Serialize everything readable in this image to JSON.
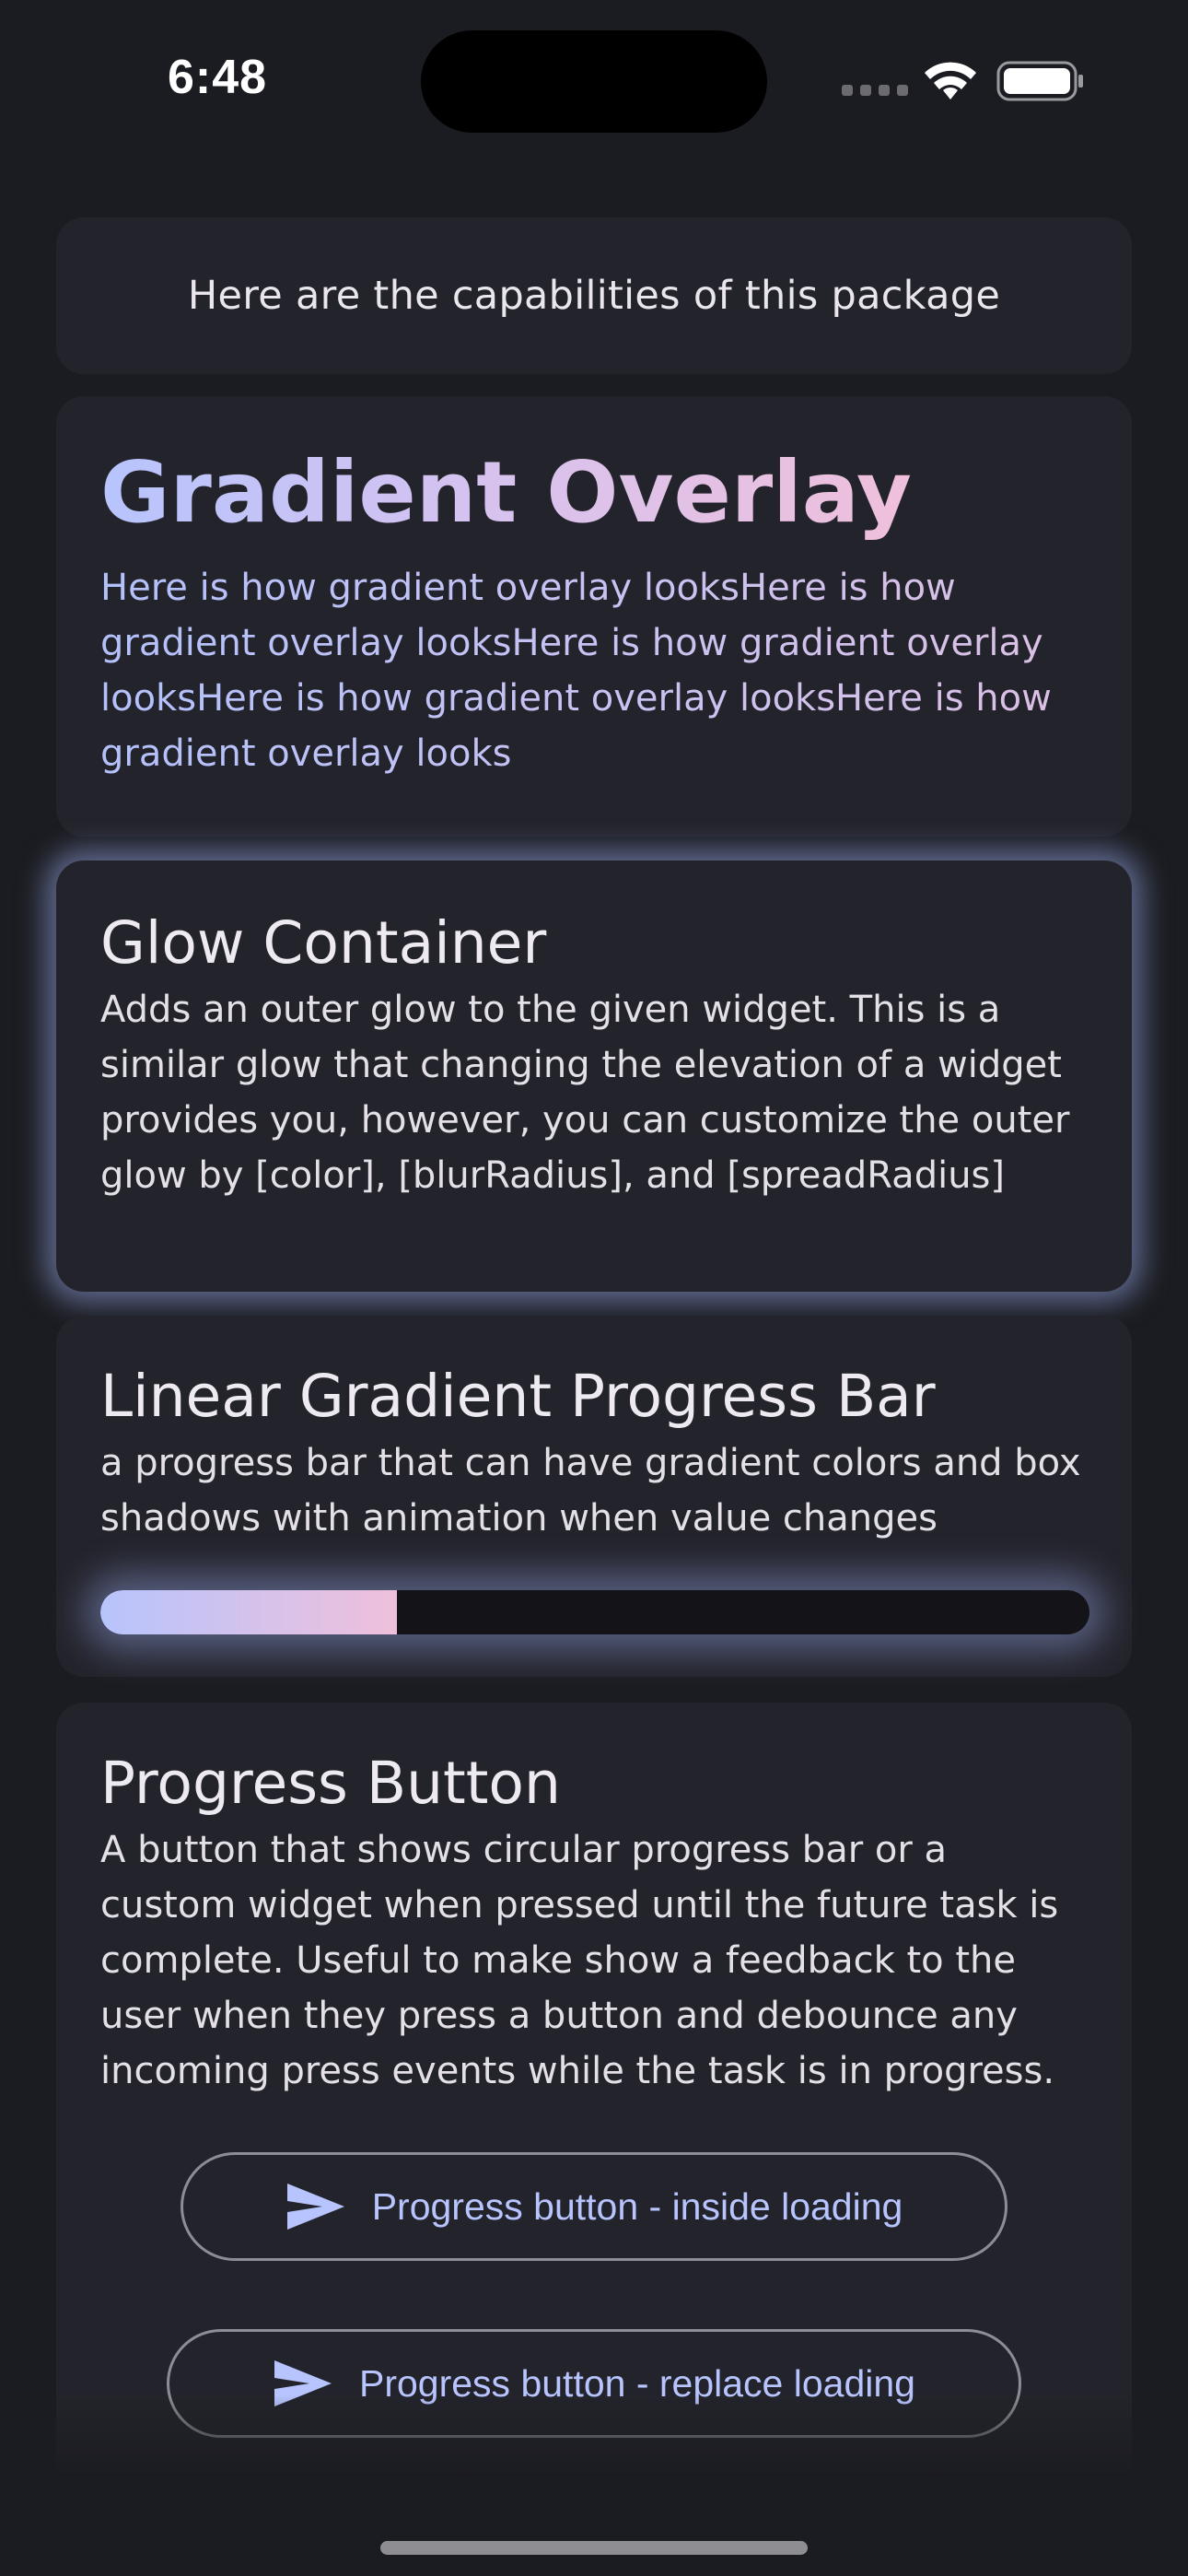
{
  "status_bar": {
    "time": "6:48",
    "icons": [
      "cellular-signal-icon",
      "wifi-icon",
      "battery-icon"
    ]
  },
  "intro": {
    "text": "Here are the capabilities of this package"
  },
  "gradient_overlay": {
    "title": "Gradient Overlay",
    "body": "Here is how gradient overlay looksHere is how gradient overlay looksHere is how gradient overlay looksHere is how gradient overlay looksHere is how gradient overlay looks",
    "gradient_colors": [
      "#b7c4fd",
      "#efc0db"
    ]
  },
  "glow_container": {
    "title": "Glow Container",
    "body": "Adds an outer glow to the given widget. This is a similar glow that changing the elevation of a widget provides you, however, you can customize the outer glow by [color], [blurRadius], and [spreadRadius]",
    "glow_color": "#96a8e6"
  },
  "linear_progress": {
    "title": "Linear Gradient Progress Bar",
    "body": "a progress bar that can have gradient colors and box shadows with animation when value changes",
    "progress_value": 0.3
  },
  "progress_button": {
    "title": "Progress Button",
    "body": "A button that shows circular progress bar or a custom widget when pressed until the future task is complete. Useful to make show a feedback to the user when they press a button and debounce any incoming press events while the task is in progress.",
    "buttons": [
      {
        "label": "Progress button - inside loading",
        "icon": "send-icon"
      },
      {
        "label": "Progress button - replace loading",
        "icon": "send-icon"
      }
    ],
    "accent_color": "#b7c4fd"
  }
}
